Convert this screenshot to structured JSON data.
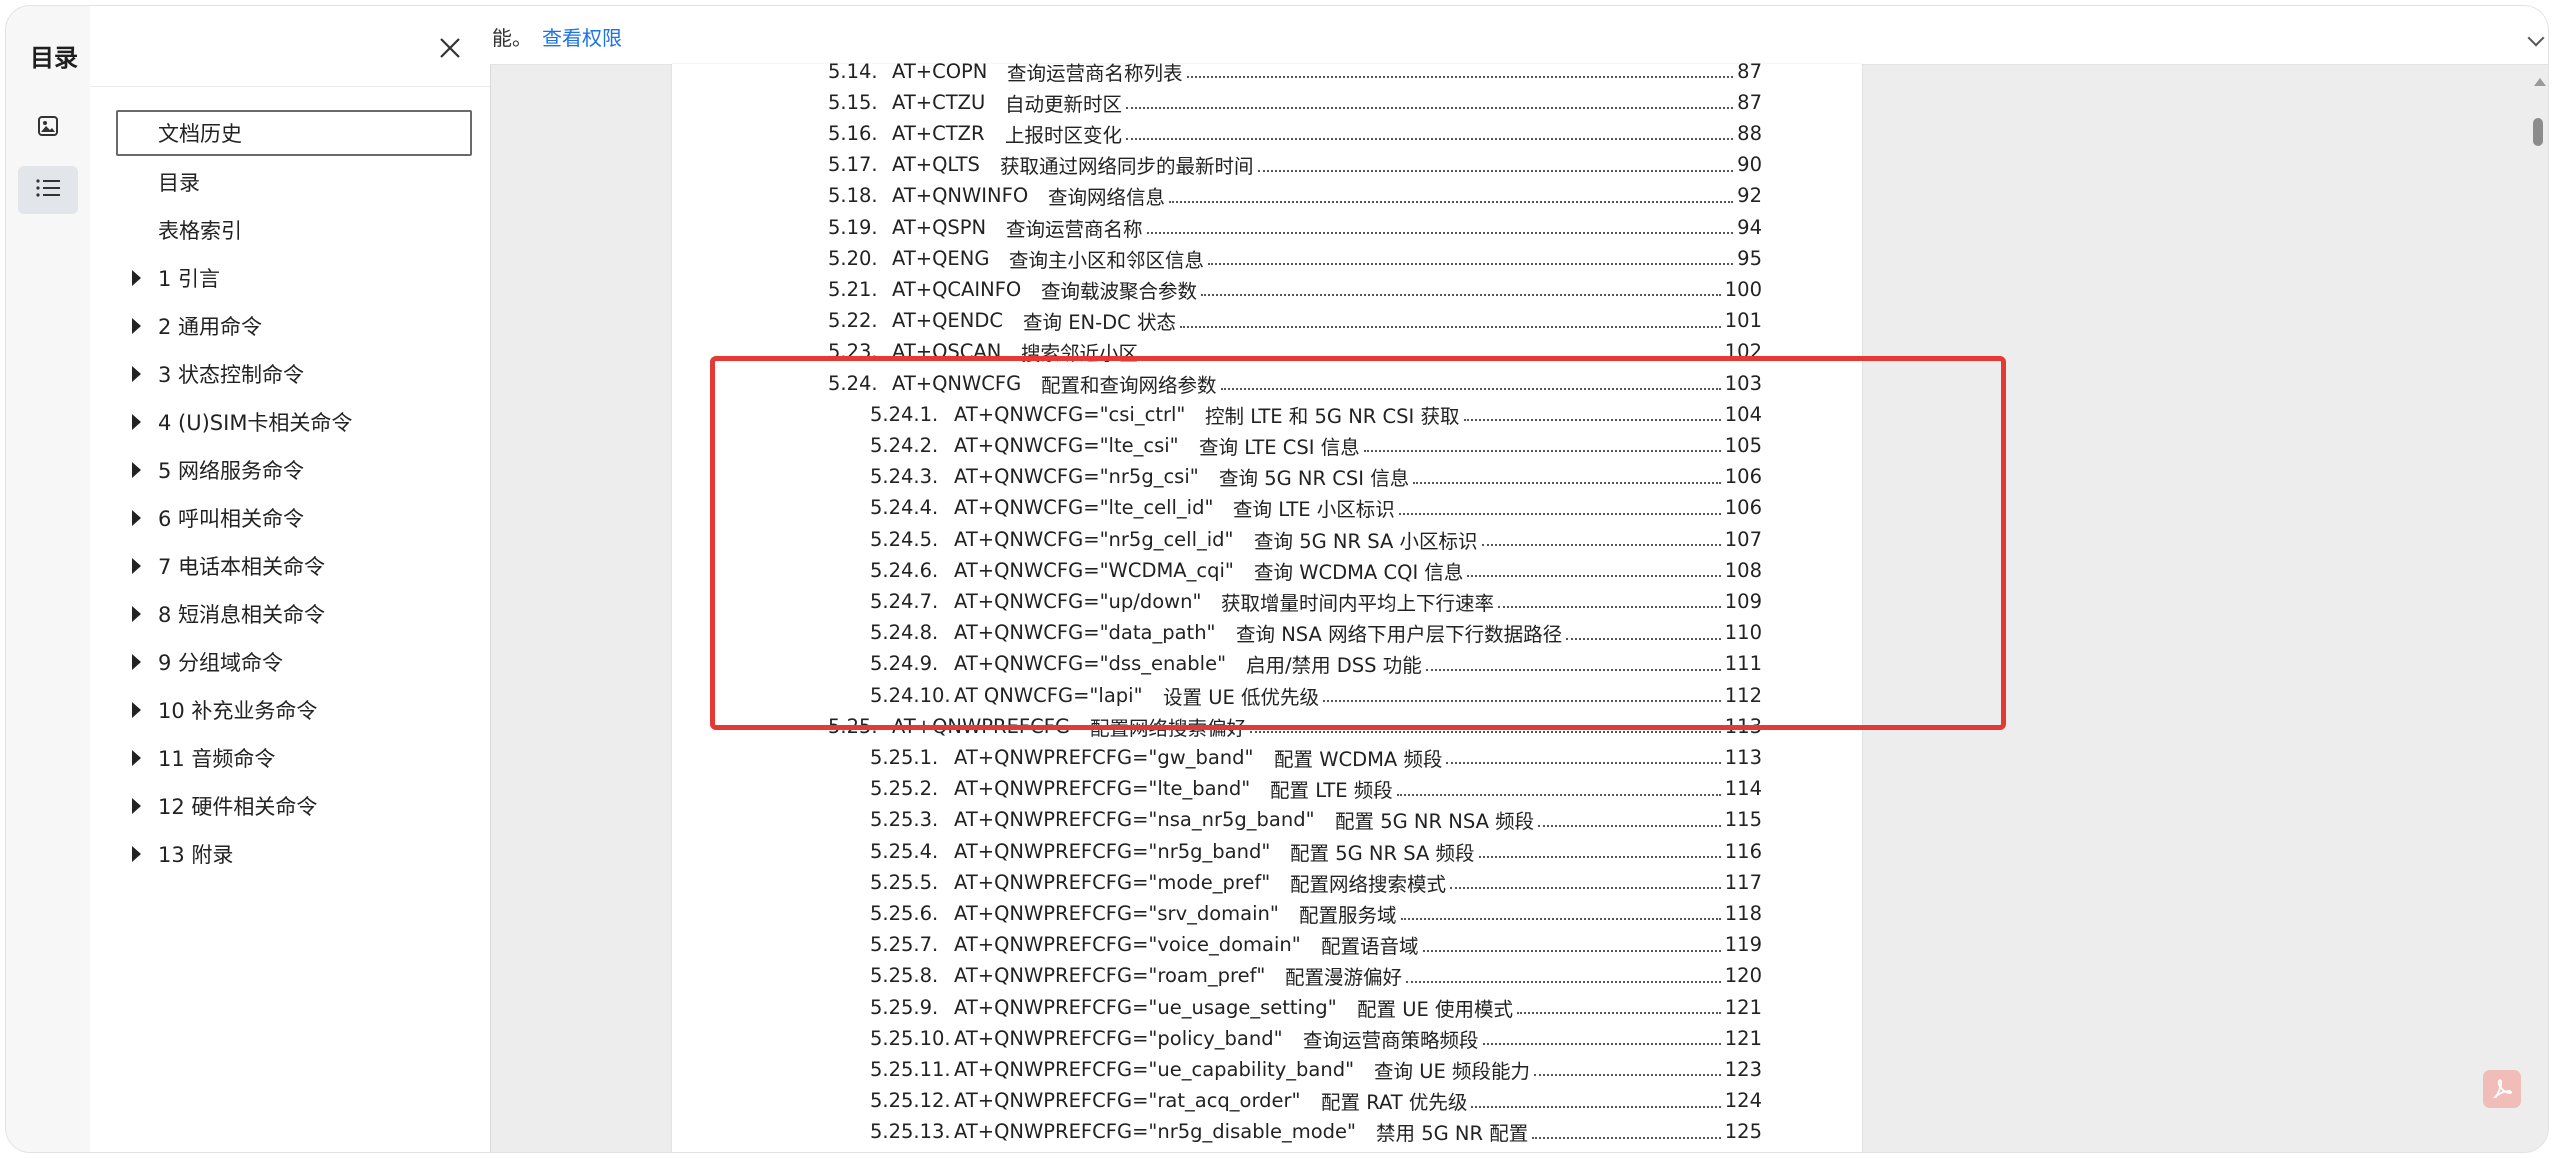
{
  "sidebar": {
    "title": "目录",
    "rail_icons": [
      "image-icon",
      "list-icon"
    ],
    "items": [
      {
        "label": "文档历史",
        "expandable": false,
        "selected": true
      },
      {
        "label": "目录",
        "expandable": false
      },
      {
        "label": "表格索引",
        "expandable": false
      },
      {
        "label": "1 引言",
        "expandable": true
      },
      {
        "label": "2 通用命令",
        "expandable": true
      },
      {
        "label": "3 状态控制命令",
        "expandable": true
      },
      {
        "label": "4 (U)SIM卡相关命令",
        "expandable": true
      },
      {
        "label": "5 网络服务命令",
        "expandable": true
      },
      {
        "label": "6 呼叫相关命令",
        "expandable": true
      },
      {
        "label": "7 电话本相关命令",
        "expandable": true
      },
      {
        "label": "8 短消息相关命令",
        "expandable": true
      },
      {
        "label": "9 分组域命令",
        "expandable": true
      },
      {
        "label": "10 补充业务命令",
        "expandable": true
      },
      {
        "label": "11 音频命令",
        "expandable": true
      },
      {
        "label": "12 硬件相关命令",
        "expandable": true
      },
      {
        "label": "13 附录",
        "expandable": true
      }
    ]
  },
  "topbar": {
    "text": "能。",
    "link": "查看权限"
  },
  "document": {
    "entries": [
      {
        "num": "5.14.",
        "cmd": "AT+COPN",
        "desc": "查询运营商名称列表",
        "page": "87",
        "level": 1
      },
      {
        "num": "5.15.",
        "cmd": "AT+CTZU",
        "desc": "自动更新时区",
        "page": "87",
        "level": 1
      },
      {
        "num": "5.16.",
        "cmd": "AT+CTZR",
        "desc": "上报时区变化",
        "page": "88",
        "level": 1
      },
      {
        "num": "5.17.",
        "cmd": "AT+QLTS",
        "desc": "获取通过网络同步的最新时间",
        "page": "90",
        "level": 1
      },
      {
        "num": "5.18.",
        "cmd": "AT+QNWINFO",
        "desc": "查询网络信息",
        "page": "92",
        "level": 1
      },
      {
        "num": "5.19.",
        "cmd": "AT+QSPN",
        "desc": "查询运营商名称",
        "page": "94",
        "level": 1
      },
      {
        "num": "5.20.",
        "cmd": "AT+QENG",
        "desc": "查询主小区和邻区信息",
        "page": "95",
        "level": 1
      },
      {
        "num": "5.21.",
        "cmd": "AT+QCAINFO",
        "desc": "查询载波聚合参数",
        "page": "100",
        "level": 1
      },
      {
        "num": "5.22.",
        "cmd": "AT+QENDC",
        "desc": "查询 EN-DC 状态",
        "page": "101",
        "level": 1
      },
      {
        "num": "5.23.",
        "cmd": "AT+QSCAN",
        "desc": "搜索邻近小区",
        "page": "102",
        "level": 1
      },
      {
        "num": "5.24.",
        "cmd": "AT+QNWCFG",
        "desc": "配置和查询网络参数",
        "page": "103",
        "level": 1
      },
      {
        "num": "5.24.1.",
        "cmd": "AT+QNWCFG=\"csi_ctrl\"",
        "desc": "控制 LTE 和 5G NR CSI 获取",
        "page": "104",
        "level": 2
      },
      {
        "num": "5.24.2.",
        "cmd": "AT+QNWCFG=\"lte_csi\"",
        "desc": "查询 LTE CSI 信息",
        "page": "105",
        "level": 2
      },
      {
        "num": "5.24.3.",
        "cmd": "AT+QNWCFG=\"nr5g_csi\"",
        "desc": "查询 5G NR CSI 信息",
        "page": "106",
        "level": 2
      },
      {
        "num": "5.24.4.",
        "cmd": "AT+QNWCFG=\"lte_cell_id\"",
        "desc": "查询 LTE 小区标识",
        "page": "106",
        "level": 2
      },
      {
        "num": "5.24.5.",
        "cmd": "AT+QNWCFG=\"nr5g_cell_id\"",
        "desc": "查询 5G NR SA 小区标识",
        "page": "107",
        "level": 2
      },
      {
        "num": "5.24.6.",
        "cmd": "AT+QNWCFG=\"WCDMA_cqi\"",
        "desc": "查询 WCDMA CQI 信息",
        "page": "108",
        "level": 2
      },
      {
        "num": "5.24.7.",
        "cmd": "AT+QNWCFG=\"up/down\"",
        "desc": "获取增量时间内平均上下行速率",
        "page": "109",
        "level": 2
      },
      {
        "num": "5.24.8.",
        "cmd": "AT+QNWCFG=\"data_path\"",
        "desc": "查询 NSA 网络下用户层下行数据路径",
        "page": "110",
        "level": 2
      },
      {
        "num": "5.24.9.",
        "cmd": "AT+QNWCFG=\"dss_enable\"",
        "desc": "启用/禁用 DSS 功能",
        "page": "111",
        "level": 2
      },
      {
        "num": "5.24.10.",
        "cmd": "AT QNWCFG=\"lapi\"",
        "desc": "设置 UE 低优先级",
        "page": "112",
        "level": 2
      },
      {
        "num": "5.25.",
        "cmd": "AT+QNWPREFCFG",
        "desc": "配置网络搜索偏好",
        "page": "113",
        "level": 1
      },
      {
        "num": "5.25.1.",
        "cmd": "AT+QNWPREFCFG=\"gw_band\"",
        "desc": "配置 WCDMA 频段",
        "page": "113",
        "level": 2
      },
      {
        "num": "5.25.2.",
        "cmd": "AT+QNWPREFCFG=\"lte_band\"",
        "desc": "配置 LTE 频段",
        "page": "114",
        "level": 2
      },
      {
        "num": "5.25.3.",
        "cmd": "AT+QNWPREFCFG=\"nsa_nr5g_band\"",
        "desc": "配置 5G NR NSA 频段",
        "page": "115",
        "level": 2
      },
      {
        "num": "5.25.4.",
        "cmd": "AT+QNWPREFCFG=\"nr5g_band\"",
        "desc": "配置 5G NR SA 频段",
        "page": "116",
        "level": 2
      },
      {
        "num": "5.25.5.",
        "cmd": "AT+QNWPREFCFG=\"mode_pref\"",
        "desc": "配置网络搜索模式",
        "page": "117",
        "level": 2
      },
      {
        "num": "5.25.6.",
        "cmd": "AT+QNWPREFCFG=\"srv_domain\"",
        "desc": "配置服务域",
        "page": "118",
        "level": 2
      },
      {
        "num": "5.25.7.",
        "cmd": "AT+QNWPREFCFG=\"voice_domain\"",
        "desc": "配置语音域",
        "page": "119",
        "level": 2
      },
      {
        "num": "5.25.8.",
        "cmd": "AT+QNWPREFCFG=\"roam_pref\"",
        "desc": "配置漫游偏好",
        "page": "120",
        "level": 2
      },
      {
        "num": "5.25.9.",
        "cmd": "AT+QNWPREFCFG=\"ue_usage_setting\"",
        "desc": "配置 UE 使用模式",
        "page": "121",
        "level": 2
      },
      {
        "num": "5.25.10.",
        "cmd": "AT+QNWPREFCFG=\"policy_band\"",
        "desc": "查询运营商策略频段",
        "page": "121",
        "level": 2
      },
      {
        "num": "5.25.11.",
        "cmd": "AT+QNWPREFCFG=\"ue_capability_band\"",
        "desc": "查询 UE 频段能力",
        "page": "123",
        "level": 2
      },
      {
        "num": "5.25.12.",
        "cmd": "AT+QNWPREFCFG=\"rat_acq_order\"",
        "desc": "配置 RAT 优先级",
        "page": "124",
        "level": 2
      },
      {
        "num": "5.25.13.",
        "cmd": "AT+QNWPREFCFG=\"nr5g_disable_mode\"",
        "desc": "禁用 5G NR 配置",
        "page": "125",
        "level": 2
      }
    ]
  },
  "colors": {
    "highlight": "#e53935",
    "link": "#1a73e8"
  }
}
